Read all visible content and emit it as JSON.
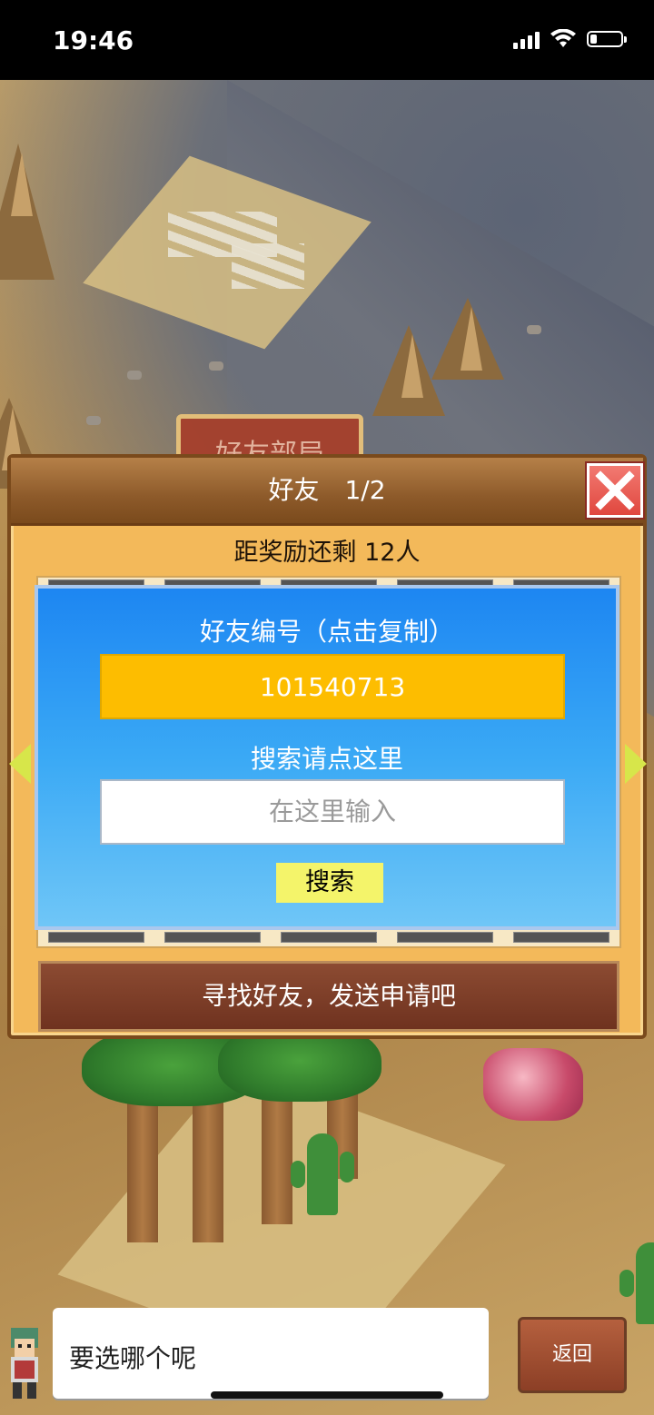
{
  "status_bar": {
    "time": "19:46"
  },
  "background_tab": {
    "label": "好友部局"
  },
  "panel": {
    "title": "好友",
    "page": "1/2",
    "reward_text": "距奖励还剩 12人",
    "find_friends_label": "寻找好友，发送申请吧"
  },
  "popup": {
    "title": "好友编号（点击复制）",
    "friend_code": "101540713",
    "search_hint": "搜索请点这里",
    "search_placeholder": "在这里输入",
    "search_button": "搜索"
  },
  "dialog": {
    "text": "要选哪个呢"
  },
  "back_button": {
    "label": "返回"
  },
  "colors": {
    "panel_bg": "#f3b95a",
    "header_brown": "#8d5a2a",
    "close_red": "#e0473e",
    "popup_blue": "#1d86f2",
    "code_yellow": "#fdbd00",
    "search_button_yellow": "#f4f46a"
  },
  "icons": [
    "signal-icon",
    "wifi-icon",
    "battery-icon",
    "close-icon",
    "arrow-left-icon",
    "arrow-right-icon",
    "character-avatar"
  ]
}
